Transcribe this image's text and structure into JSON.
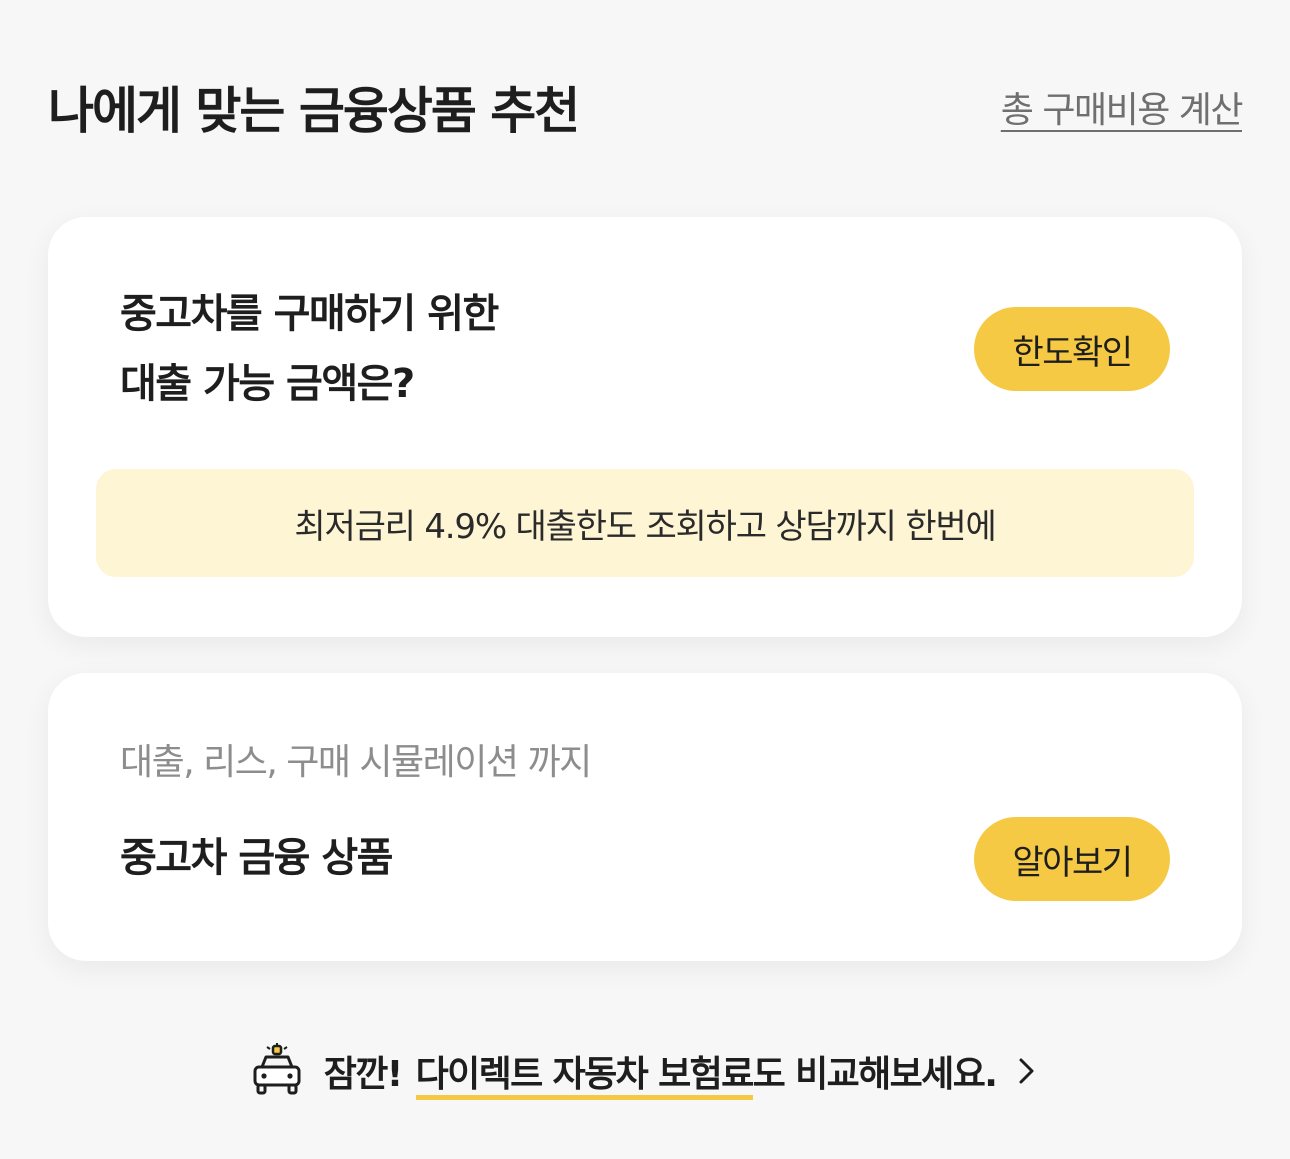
{
  "header": {
    "title": "나에게 맞는 금융상품 추천",
    "total_cost_link": "총 구매비용 계산"
  },
  "loan_card": {
    "question_line1": "중고차를 구매하기 위한",
    "question_line2": "대출 가능 금액은?",
    "button_label": "한도확인",
    "promo_text": "최저금리 4.9% 대출한도 조회하고 상담까지 한번에"
  },
  "products_card": {
    "subtitle": "대출, 리스, 구매 시뮬레이션 까지",
    "title": "중고차 금융 상품",
    "button_label": "알아보기"
  },
  "notice": {
    "icon": "car-siren-icon",
    "prefix": "잠깐!",
    "highlight": "다이렉트 자동차 보험료",
    "suffix": "도 비교해보세요.",
    "chevron_icon": "chevron-right-icon"
  },
  "colors": {
    "accent": "#f6c944",
    "banner_bg": "#fdf5d4",
    "page_bg": "#f7f7f7"
  }
}
